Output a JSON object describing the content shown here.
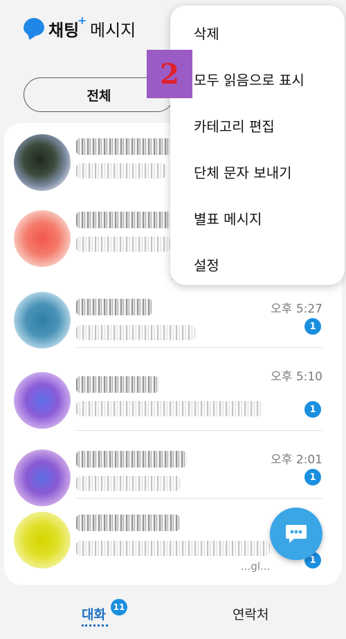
{
  "header": {
    "app_name": "채팅",
    "plus": "+",
    "title": "메시지"
  },
  "filter": {
    "label": "전체"
  },
  "annotation": {
    "label": "2"
  },
  "menu": {
    "items": [
      "삭제",
      "모두 읽음으로 표시",
      "카테고리 편집",
      "단체 문자 보내기",
      "별표 메시지",
      "설정"
    ]
  },
  "conversations": [
    {
      "time": "오후 5:27",
      "unread": "1"
    },
    {
      "time": "오후 5:10",
      "unread": "1"
    },
    {
      "time": "오후 2:01",
      "unread": "1"
    },
    {
      "unread": "1",
      "snippet": "...gl..."
    }
  ],
  "nav": {
    "chats_label": "대화",
    "chats_badge": "11",
    "contacts_label": "연락처"
  },
  "colors": {
    "accent": "#1a8fe0",
    "fab": "#3aa6e6",
    "annotation": "#9b5bc4"
  }
}
